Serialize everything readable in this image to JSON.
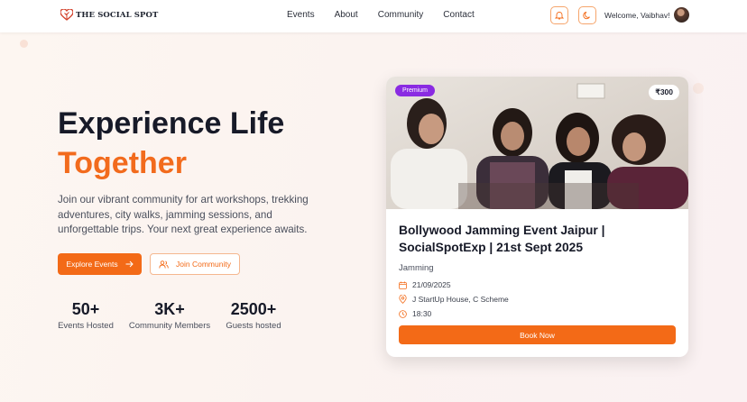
{
  "nav": {
    "brand": "THE SOCIAL SPOT",
    "links": [
      "Events",
      "About",
      "Community",
      "Contact"
    ],
    "welcome": "Welcome, Vaibhav!"
  },
  "hero": {
    "title_line1": "Experience Life",
    "title_line2": "Together",
    "description": "Join our vibrant community for art workshops, trekking adventures, city walks, jamming sessions, and unforgettable trips. Your next great experience awaits.",
    "primary_button": "Explore Events",
    "secondary_button": "Join Community",
    "stats": [
      {
        "value": "50+",
        "label": "Events Hosted"
      },
      {
        "value": "3K+",
        "label": "Community Members"
      },
      {
        "value": "2500+",
        "label": "Guests hosted"
      }
    ]
  },
  "event_card": {
    "badge": "Premium",
    "price": "₹300",
    "title": "Bollywood Jamming Event Jaipur | SocialSpotExp | 21st Sept 2025",
    "category": "Jamming",
    "date": "21/09/2025",
    "location": "J StartUp House, C Scheme",
    "time": "18:30",
    "cta": "Book Now"
  },
  "colors": {
    "accent": "#f36a17",
    "premium": "#8a2be2",
    "heading": "#171a28"
  }
}
